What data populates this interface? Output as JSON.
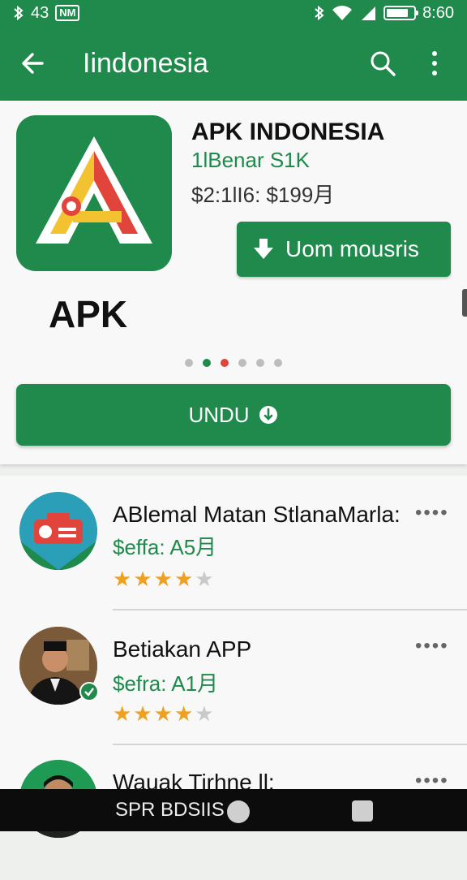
{
  "status_bar": {
    "left_text": "43",
    "badge_text": "NM",
    "time": "8:60"
  },
  "app_bar": {
    "title": "Iindonesia",
    "icons": [
      "back-arrow-icon",
      "search-icon",
      "more-vert-icon"
    ]
  },
  "featured": {
    "icon_letter": "A",
    "icon_label": "APK",
    "name": "APK INDONESIA",
    "subtitle": "1lBenar S1K",
    "price": "$2:1lI6: $199月",
    "download_button": "Uom mousris",
    "carousel": {
      "dots": 6,
      "active_green": 1,
      "active_red": 2
    },
    "action_button": "UNDU"
  },
  "list": {
    "items": [
      {
        "name": "ABlemal Matan StlanaMarla:",
        "price": "$effa: A5月",
        "rating": 4.5,
        "more": "••••"
      },
      {
        "name": "Betiakan APP",
        "price": "$efra: A1月",
        "rating": 4.5,
        "more": "••••"
      },
      {
        "name": "Wauak Tirhne ll:",
        "more": "••••"
      }
    ]
  },
  "nav_bar": {
    "text": "SPR BDSIIS"
  },
  "colors": {
    "primary": "#1f8a4c",
    "accent_red": "#e0443a",
    "star": "#f0a020"
  }
}
